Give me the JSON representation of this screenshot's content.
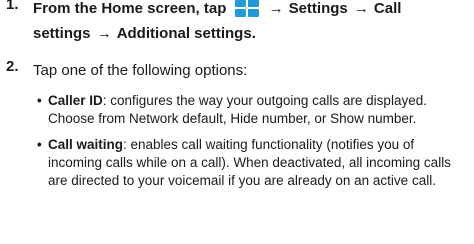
{
  "step1": {
    "number": "1.",
    "intro": "From the Home screen, tap",
    "icon": "apps-menu-icon",
    "icon_color": "#1f9ad8",
    "arrow": "→",
    "path1": "Settings",
    "path2": "Call settings",
    "path3": "Additional settings",
    "end": "."
  },
  "step2": {
    "number": "2.",
    "text": "Tap one of the following options:"
  },
  "options": [
    {
      "bullet": "•",
      "term": "Caller ID",
      "desc": ": configures the way your outgoing calls are displayed. Choose from Network default, Hide number, or Show number."
    },
    {
      "bullet": "•",
      "term": "Call waiting",
      "desc": ": enables call waiting functionality (notifies you of incoming calls while on a call). When deactivated, all incoming calls are directed to your voicemail if you are already on an active call."
    }
  ]
}
